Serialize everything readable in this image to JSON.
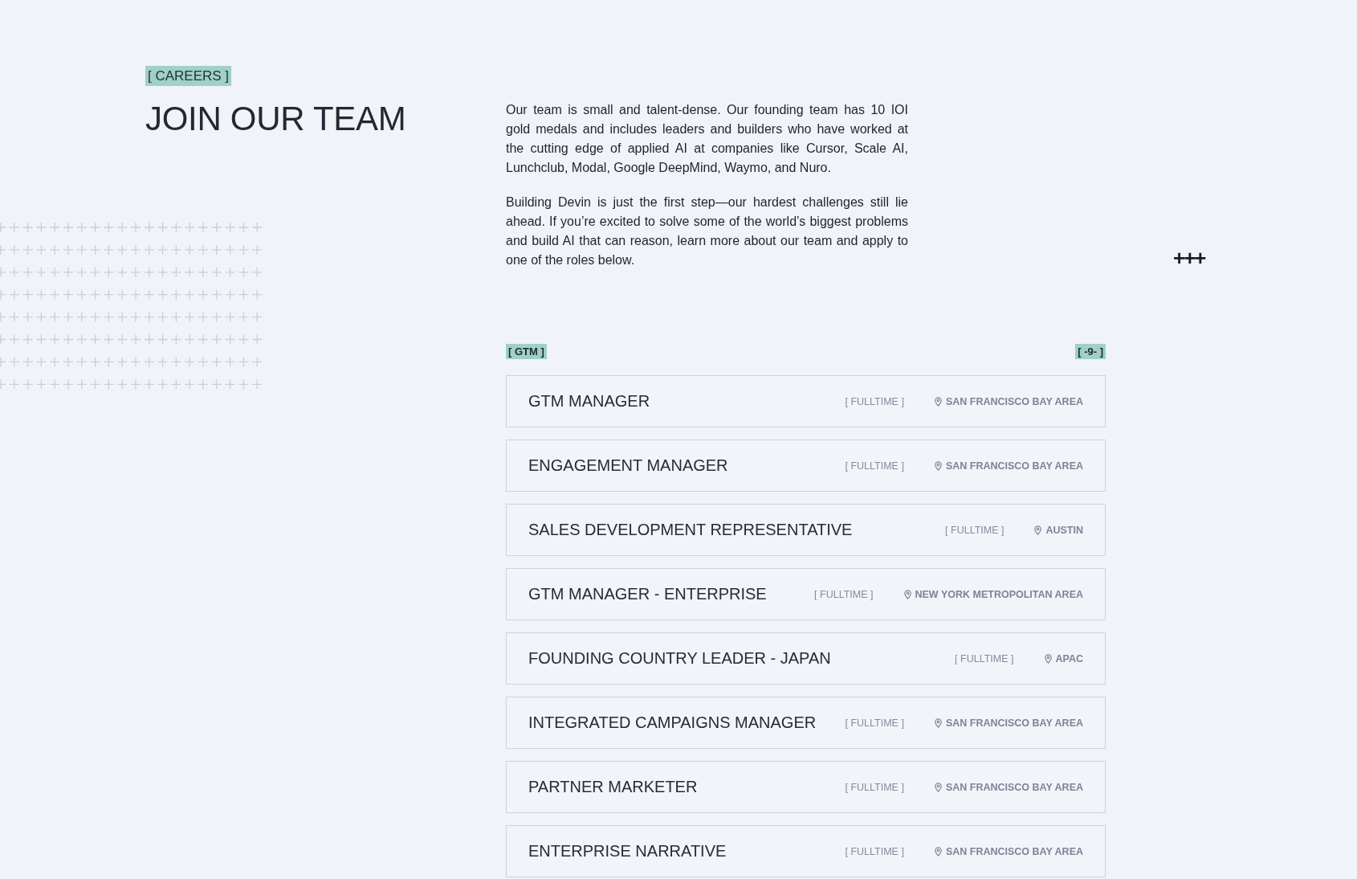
{
  "header": {
    "tag": "[ CAREERS ]",
    "title": "JOIN OUR TEAM"
  },
  "intro": {
    "paragraphs": [
      "Our team is small and talent-dense. Our founding team has 10 IOI gold medals and includes leaders and builders who have worked at the cutting edge of applied AI at companies like Cursor, Scale AI, Lunchclub, Modal, Google DeepMind, Waymo, and Nuro.",
      "Building Devin is just the first step—our hardest challenges still lie ahead. If you’re excited to solve some of the world’s biggest problems and build AI that can reason, learn more about our team and apply to one of the roles below."
    ],
    "mark": "+++"
  },
  "jobs": {
    "category": "[ GTM ]",
    "count": "[ -9- ]",
    "rows": [
      {
        "title": "GTM MANAGER",
        "type": "[ FULLTIME ]",
        "location": "SAN FRANCISCO BAY AREA"
      },
      {
        "title": "ENGAGEMENT MANAGER",
        "type": "[ FULLTIME ]",
        "location": "SAN FRANCISCO BAY AREA"
      },
      {
        "title": "SALES DEVELOPMENT REPRESENTATIVE",
        "type": "[ FULLTIME ]",
        "location": "AUSTIN"
      },
      {
        "title": "GTM MANAGER - ENTERPRISE",
        "type": "[ FULLTIME ]",
        "location": "NEW YORK METROPOLITAN AREA"
      },
      {
        "title": "FOUNDING COUNTRY LEADER - JAPAN",
        "type": "[ FULLTIME ]",
        "location": "APAC"
      },
      {
        "title": "INTEGRATED CAMPAIGNS MANAGER",
        "type": "[ FULLTIME ]",
        "location": "SAN FRANCISCO BAY AREA"
      },
      {
        "title": "PARTNER MARKETER",
        "type": "[ FULLTIME ]",
        "location": "SAN FRANCISCO BAY AREA"
      },
      {
        "title": "ENTERPRISE NARRATIVE",
        "type": "[ FULLTIME ]",
        "location": "SAN FRANCISCO BAY AREA"
      }
    ]
  }
}
